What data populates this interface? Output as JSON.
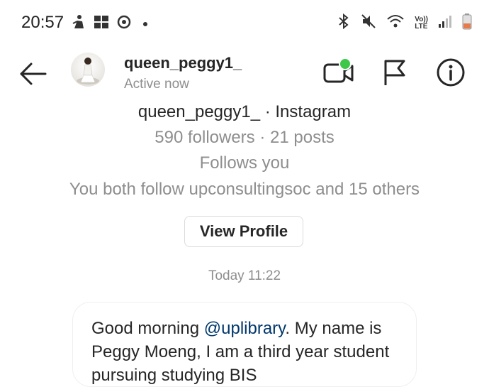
{
  "status_bar": {
    "time": "20:57",
    "lte_label": "Vo))\nLTE"
  },
  "header": {
    "username": "queen_peggy1_",
    "status": "Active now"
  },
  "profile": {
    "name_line": "queen_peggy1_ · Instagram",
    "stats": "590 followers · 21 posts",
    "follows_you": "Follows you",
    "mutual": "You both follow upconsultingsoc and 15 others",
    "view_profile_label": "View Profile"
  },
  "chat": {
    "timestamp": "Today 11:22",
    "message": {
      "prefix": "Good morning ",
      "mention": "@uplibrary",
      "suffix": ". My name is Peggy Moeng, I am a third year student pursuing studying BIS"
    }
  },
  "colors": {
    "accent_green": "#3ec84a",
    "muted_text": "#8e8e8e",
    "mention": "#00376b"
  }
}
